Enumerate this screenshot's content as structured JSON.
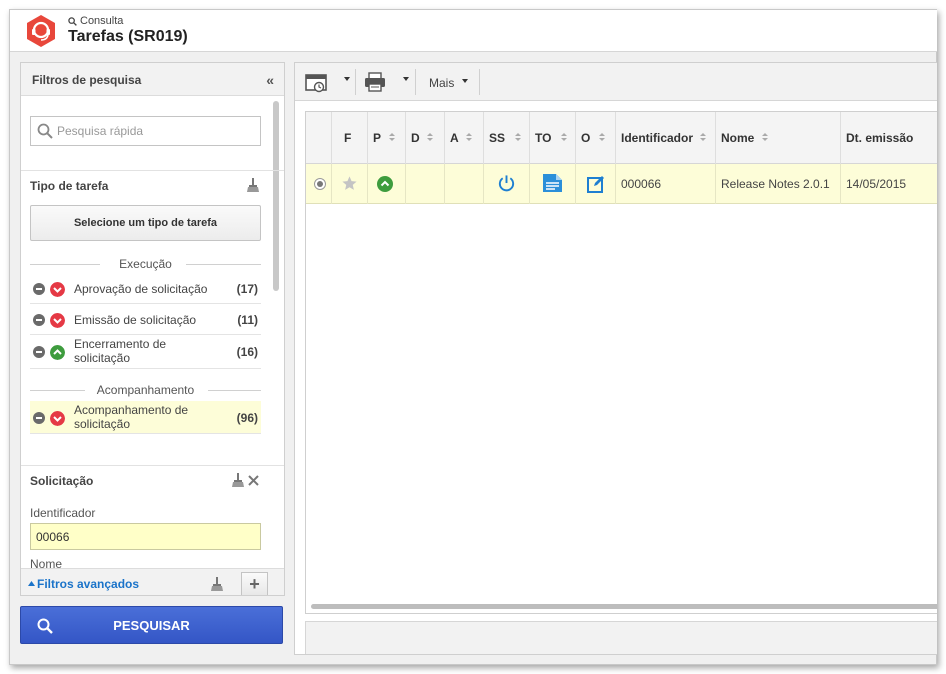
{
  "header": {
    "subtitle": "Consulta",
    "title": "Tarefas (SR019)",
    "brand_color": "#e8473b"
  },
  "filters": {
    "title": "Filtros de pesquisa",
    "collapse_icon": "«",
    "quick_search_placeholder": "Pesquisa rápida",
    "task_type": {
      "title": "Tipo de tarefa",
      "select_button": "Selecione um tipo de tarefa"
    },
    "groups": [
      {
        "label": "Execução",
        "items": [
          {
            "label": "Aprovação de solicitação",
            "count": "(17)",
            "status": "down",
            "status_color": "#e53945"
          },
          {
            "label": "Emissão de solicitação",
            "count": "(11)",
            "status": "down",
            "status_color": "#e53945"
          },
          {
            "label": "Encerramento de solicitação",
            "count": "(16)",
            "status": "up",
            "status_color": "#3e9c3e"
          }
        ]
      },
      {
        "label": "Acompanhamento",
        "items": [
          {
            "label": "Acompanhamento de solicitação",
            "count": "(96)",
            "status": "down",
            "status_color": "#e53945",
            "selected": true
          }
        ]
      }
    ],
    "solicitacao": {
      "title": "Solicitação",
      "identifier_label": "Identificador",
      "identifier_value": "00066",
      "name_label": "Nome"
    },
    "advanced_link": "Filtros avançados",
    "add_label": "+"
  },
  "search_button": "PESQUISAR",
  "toolbar": {
    "mais_label": "Mais"
  },
  "grid": {
    "columns": [
      "F",
      "P",
      "D",
      "A",
      "SS",
      "TO",
      "O",
      "Identificador",
      "Nome",
      "Dt. emissão"
    ],
    "rows": [
      {
        "identifier": "000066",
        "name": "Release Notes 2.0.1",
        "date": "14/05/2015"
      }
    ]
  }
}
